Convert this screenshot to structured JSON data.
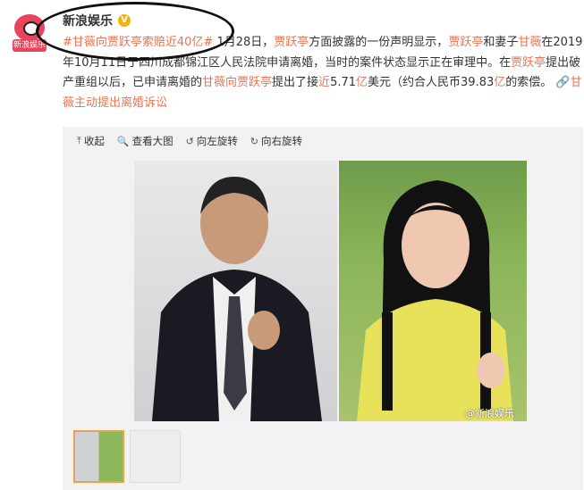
{
  "avatar": {
    "badge_text": "新浪娱乐",
    "icon": "sina-ent-logo"
  },
  "user": {
    "name": "新浪娱乐",
    "verified_icon": "verified-badge-icon"
  },
  "post": {
    "hashtag": "#甘薇向贾跃亭索赔近40亿#",
    "segments": [
      {
        "text": " 1月28日，",
        "type": "text"
      },
      {
        "text": "贾跃亭",
        "type": "hl"
      },
      {
        "text": "方面披露的一份声明显示，",
        "type": "text"
      },
      {
        "text": "贾跃亭",
        "type": "hl"
      },
      {
        "text": "和妻子",
        "type": "text"
      },
      {
        "text": "甘薇",
        "type": "hl"
      },
      {
        "text": "在2019年10月11日于四川成都锦江区人民法院申请离婚，当时的案件状态显示正在审理中。在",
        "type": "text"
      },
      {
        "text": "贾跃亭",
        "type": "hl"
      },
      {
        "text": "提出破产重组以后，已申请离婚的",
        "type": "text"
      },
      {
        "text": "甘薇向贾跃亭",
        "type": "hl"
      },
      {
        "text": "提出了接",
        "type": "text"
      },
      {
        "text": "近",
        "type": "hl"
      },
      {
        "text": "5.71",
        "type": "text"
      },
      {
        "text": "亿",
        "type": "hl"
      },
      {
        "text": "美元（约合人民币39.83",
        "type": "text"
      },
      {
        "text": "亿",
        "type": "hl"
      },
      {
        "text": "的索偿。",
        "type": "text"
      }
    ],
    "topic_link": "甘薇主动提出离婚诉讼"
  },
  "toolbar": {
    "collapse": "收起",
    "view_large": "查看大图",
    "rotate_left": "向左旋转",
    "rotate_right": "向右旋转"
  },
  "media": {
    "watermark": "@新浪娱乐"
  },
  "colors": {
    "highlight": "#eb7350",
    "panel": "#f2f2f5",
    "thumb_active": "#f0a04b"
  }
}
